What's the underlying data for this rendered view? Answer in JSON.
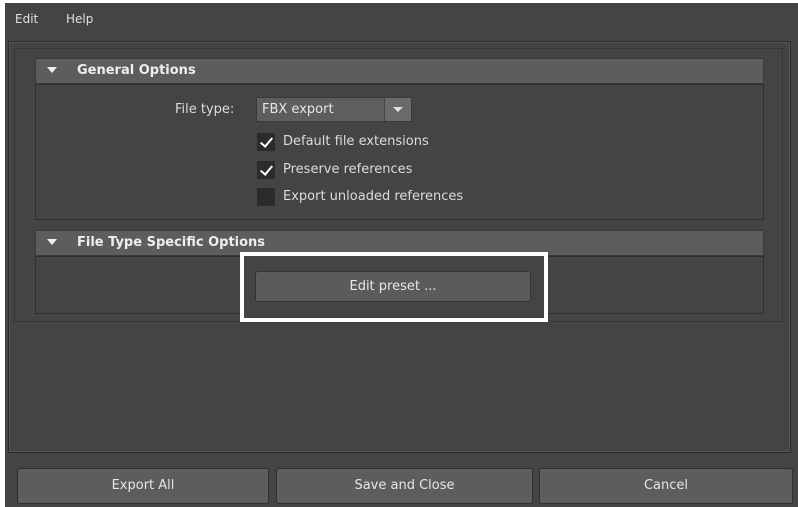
{
  "menu": {
    "edit": "Edit",
    "help": "Help"
  },
  "general_options": {
    "title": "General Options",
    "file_type_label": "File type:",
    "file_type_value": "FBX export",
    "checkboxes": [
      {
        "label": "Default file extensions",
        "checked": true
      },
      {
        "label": "Preserve references",
        "checked": true
      },
      {
        "label": "Export unloaded references",
        "checked": false
      }
    ]
  },
  "file_type_specific": {
    "title": "File Type Specific Options",
    "edit_preset_label": "Edit preset ..."
  },
  "buttons": {
    "export_all": "Export All",
    "save_and_close": "Save and Close",
    "cancel": "Cancel"
  },
  "colors": {
    "window_bg": "#444444",
    "highlight_border": "#ffffff"
  }
}
